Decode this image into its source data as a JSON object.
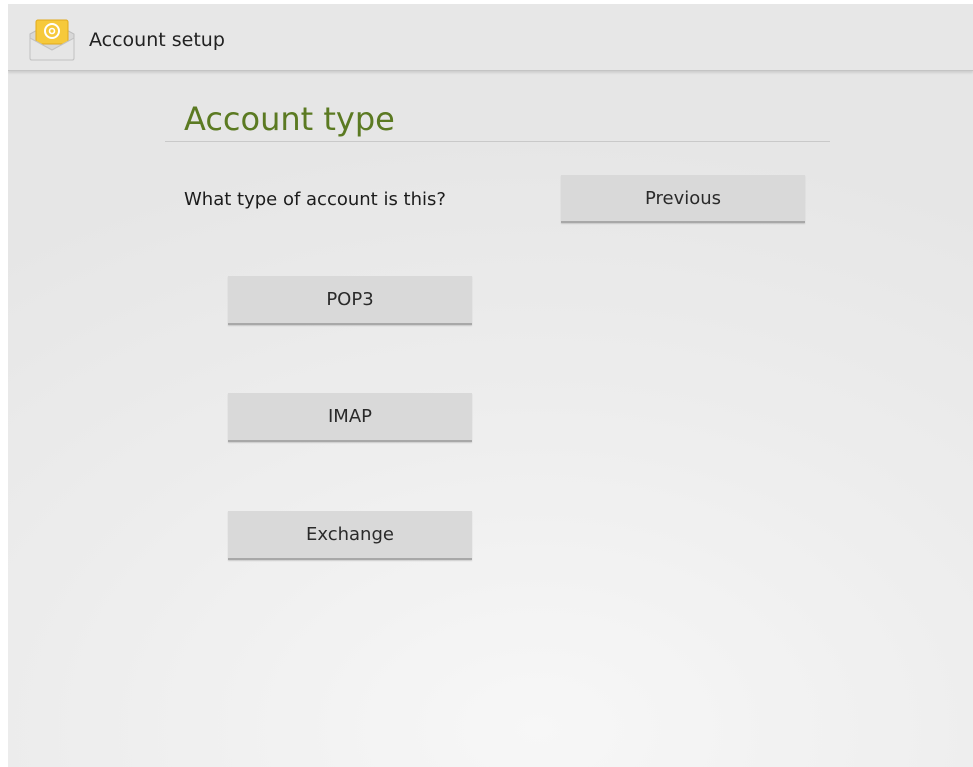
{
  "action_bar": {
    "icon": "email-app-icon",
    "title": "Account setup"
  },
  "page": {
    "title": "Account type",
    "question": "What type of account is this?"
  },
  "buttons": {
    "previous": "Previous",
    "pop3": "POP3",
    "imap": "IMAP",
    "exchange": "Exchange"
  },
  "colors": {
    "title_green": "#5b7a22",
    "button_bg": "#d9d9d9",
    "background": "#ececec"
  }
}
